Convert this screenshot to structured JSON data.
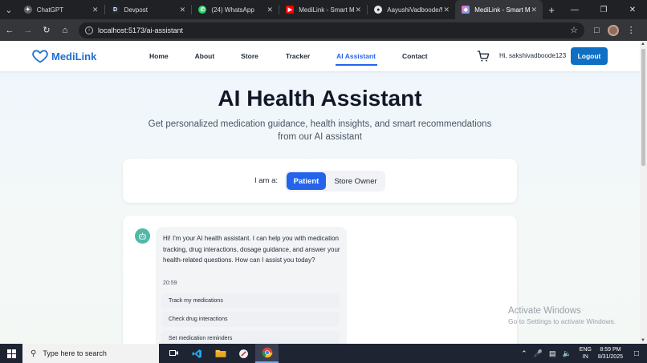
{
  "browser": {
    "tabs": [
      {
        "title": "ChatGPT",
        "icon": "chatgpt-icon",
        "active": false
      },
      {
        "title": "Devpost",
        "icon": "devpost-icon",
        "active": false
      },
      {
        "title": "(24) WhatsApp",
        "icon": "whatsapp-icon",
        "active": false
      },
      {
        "title": "MediLink - Smart Me",
        "icon": "youtube-icon",
        "active": false
      },
      {
        "title": "AayushiVadboode/M",
        "icon": "github-icon",
        "active": false
      },
      {
        "title": "MediLink - Smart Me",
        "icon": "medilink-gem-icon",
        "active": true
      }
    ],
    "url": "localhost:5173/ai-assistant"
  },
  "nav": {
    "brand": "MediLink",
    "links": [
      "Home",
      "About",
      "Store",
      "Tracker",
      "AI Assistant",
      "Contact"
    ],
    "active_link": "AI Assistant",
    "greeting": "Hi, sakshivadboode123",
    "logout": "Logout"
  },
  "hero": {
    "title": "AI Health Assistant",
    "subtitle": "Get personalized medication guidance, health insights, and smart recommendations from our AI assistant"
  },
  "role": {
    "label": "I am a:",
    "options": [
      "Patient",
      "Store Owner"
    ],
    "selected": "Patient"
  },
  "chat": {
    "message": "Hi! I'm your AI health assistant. I can help you with medication tracking, drug interactions, dosage guidance, and answer your health-related questions. How can I assist you today?",
    "time": "20:59",
    "quick_actions": [
      "Track my medications",
      "Check drug interactions",
      "Set medication reminders"
    ]
  },
  "watermark": {
    "line1": "Activate Windows",
    "line2": "Go to Settings to activate Windows."
  },
  "taskbar": {
    "search_placeholder": "Type here to search",
    "language": "ENG",
    "region": "IN",
    "time": "8:59 PM",
    "date": "8/31/2025"
  },
  "colors": {
    "primary": "#2563eb",
    "brand": "#1f6fd1",
    "logout": "#0f6fc4",
    "bot_avatar": "#4fb8a7"
  }
}
